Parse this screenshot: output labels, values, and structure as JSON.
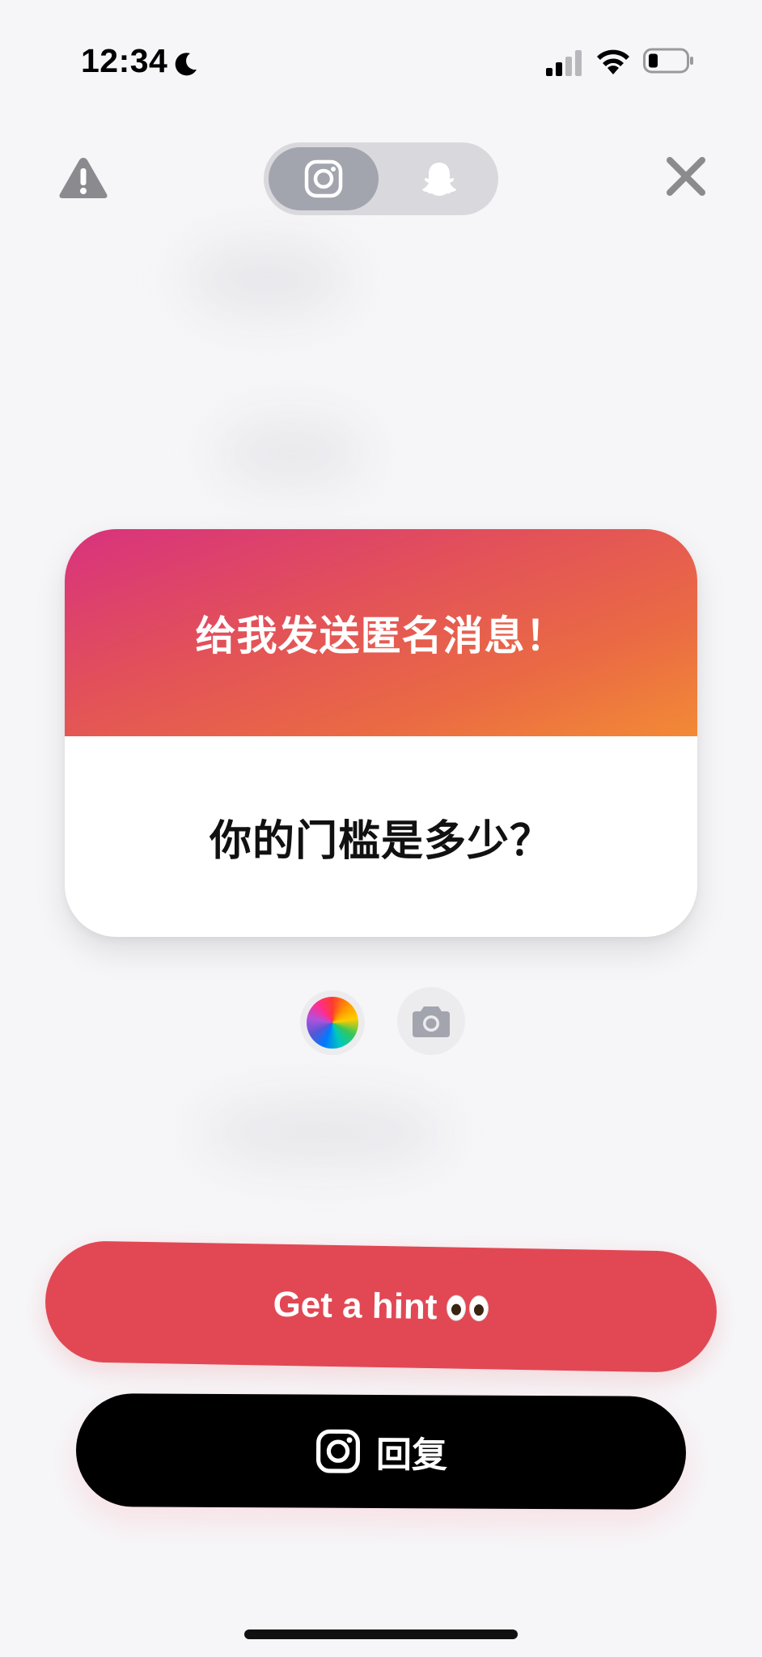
{
  "status_bar": {
    "time": "12:34",
    "moon_icon": "moon-icon",
    "signal_icon": "cellular-signal-icon",
    "wifi_icon": "wifi-icon",
    "battery_icon": "battery-icon"
  },
  "top_bar": {
    "report_icon": "warning-triangle-icon",
    "close_icon": "close-icon",
    "platforms": [
      {
        "name": "instagram",
        "icon": "instagram-icon",
        "selected": true
      },
      {
        "name": "snapchat",
        "icon": "snapchat-ghost-icon",
        "selected": false
      }
    ]
  },
  "card": {
    "title": "给我发送匿名消息！",
    "question": "你的门槛是多少？",
    "gradient_colors": [
      "#d8327e",
      "#e2505a",
      "#ea6a44",
      "#f28a35"
    ]
  },
  "tools": {
    "color_picker_icon": "color-wheel-icon",
    "camera_icon": "camera-icon"
  },
  "buttons": {
    "hint_label": "Get a hint",
    "hint_emoji_icon": "eyes-emoji-icon",
    "hint_color": "#e14854",
    "reply_label": "回复",
    "reply_icon": "instagram-icon",
    "reply_color": "#000000"
  }
}
